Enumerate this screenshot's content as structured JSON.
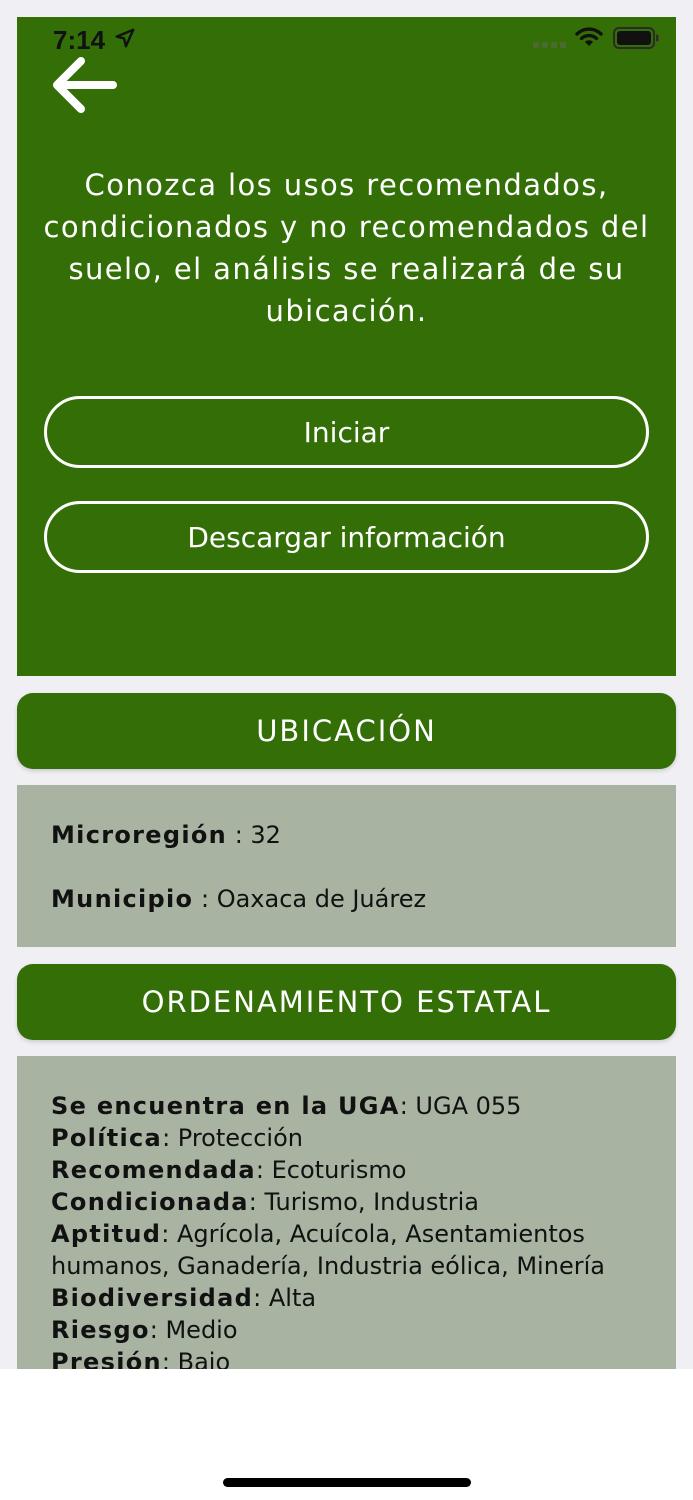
{
  "status_bar": {
    "time": "7:14"
  },
  "header": {
    "intro_text": "Conozca los usos recomendados, condicionados y no recomendados del suelo, el análisis se realizará de su ubicación.",
    "buttons": {
      "start": "Iniciar",
      "download": "Descargar información"
    }
  },
  "ubicacion": {
    "title": "UBICACIÓN",
    "fields": [
      {
        "label": "Microregión",
        "sep": " : ",
        "value": "32"
      },
      {
        "label": "Municipio",
        "sep": " : ",
        "value": "Oaxaca de Juárez"
      }
    ]
  },
  "ordenamiento": {
    "title": "ORDENAMIENTO ESTATAL",
    "fields": [
      {
        "label": "Se encuentra en la UGA",
        "sep": ": ",
        "value": "UGA 055"
      },
      {
        "label": "Política",
        "sep": ": ",
        "value": "Protección"
      },
      {
        "label": "Recomendada",
        "sep": ": ",
        "value": "Ecoturismo"
      },
      {
        "label": "Condicionada",
        "sep": ": ",
        "value": "Turismo, Industria"
      },
      {
        "label": "Aptitud",
        "sep": ": ",
        "value": "Agrícola, Acuícola, Asentamientos humanos, Ganadería, Industria eólica, Minería"
      },
      {
        "label": "Biodiversidad",
        "sep": ": ",
        "value": "Alta"
      },
      {
        "label": "Riesgo",
        "sep": ": ",
        "value": "Medio"
      },
      {
        "label": "Presión",
        "sep": ": ",
        "value": "Bajo"
      }
    ]
  },
  "icons": {
    "back": "arrow-left-icon",
    "location": "location-arrow-icon",
    "signal": "cellular-signal-icon",
    "wifi": "wifi-icon",
    "battery": "battery-icon"
  },
  "colors": {
    "primary_green": "#336f06",
    "card_gray": "#a8b3a2",
    "button_border": "#ffffff"
  }
}
